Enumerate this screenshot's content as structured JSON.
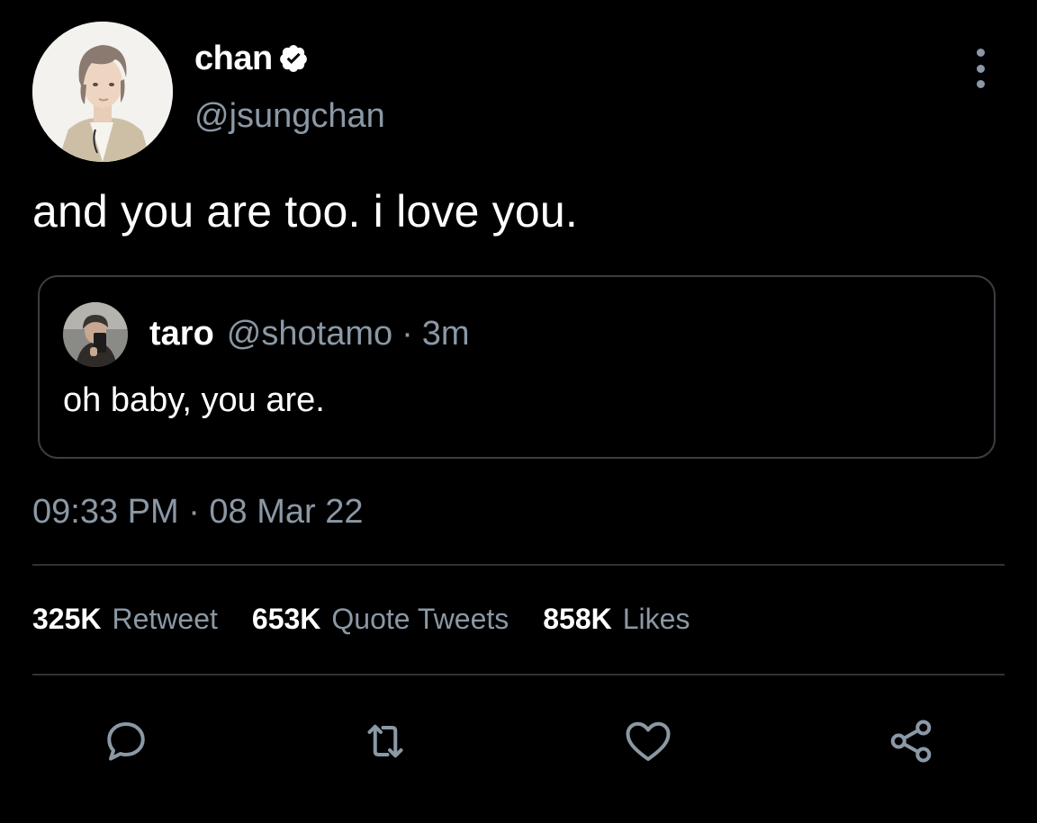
{
  "tweet": {
    "display_name": "chan",
    "handle": "@jsungchan",
    "verified": true,
    "text": "and you are too. i love you.",
    "timestamp": "09:33 PM · 08 Mar 22"
  },
  "quoted_tweet": {
    "display_name": "taro",
    "handle": "@shotamo",
    "separator": "·",
    "time": "3m",
    "text": "oh baby, you are."
  },
  "stats": {
    "retweets_count": "325K",
    "retweets_label": "Retweet",
    "quotes_count": "653K",
    "quotes_label": "Quote Tweets",
    "likes_count": "858K",
    "likes_label": "Likes"
  },
  "actions": [
    "reply-icon",
    "retweet-icon",
    "like-icon",
    "share-icon"
  ],
  "colors": {
    "background": "#000000",
    "primary_text": "#ffffff",
    "secondary_text": "#8b98a5",
    "divider": "#2f3336",
    "quote_border": "#3a3f44"
  }
}
